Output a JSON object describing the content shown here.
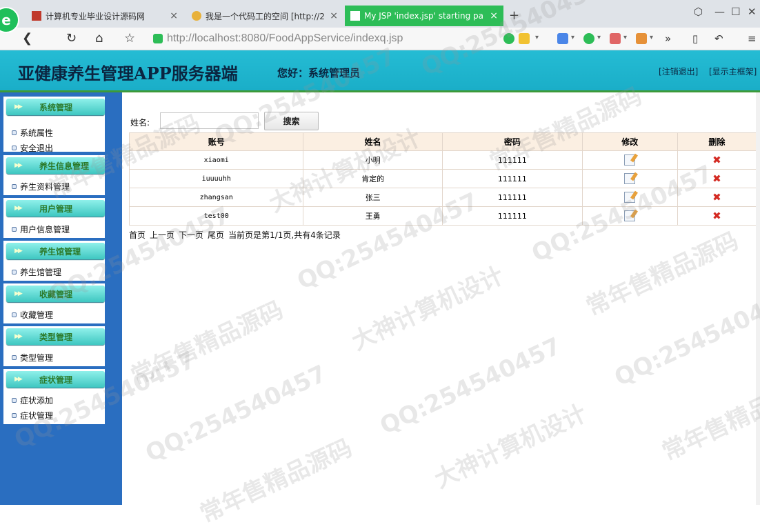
{
  "browser": {
    "logo_glyph": "e",
    "tabs": [
      {
        "label": "计算机专业毕业设计源码网",
        "active": false
      },
      {
        "label": "我是一个代码工的空间 [http://2",
        "active": false
      },
      {
        "label": "My JSP 'index.jsp' starting pa",
        "active": true
      }
    ],
    "new_tab": "+",
    "url_host": "http://localhost",
    "url_path": ":8080/FoodAppService/indexq.jsp",
    "close_glyph": "×"
  },
  "header": {
    "title": "亚健康养生管理APP服务器端",
    "greeting": "您好：系统管理员",
    "logout": "[注销退出]",
    "show_frame": "[显示主框架]"
  },
  "sidebar": {
    "sections": [
      {
        "title": "系统管理",
        "items": [
          "系统属性",
          "安全退出"
        ]
      },
      {
        "title": "养生信息管理",
        "items": [
          "养生资料管理"
        ]
      },
      {
        "title": "用户管理",
        "items": [
          "用户信息管理"
        ]
      },
      {
        "title": "养生馆管理",
        "items": [
          "养生馆管理"
        ]
      },
      {
        "title": "收藏管理",
        "items": [
          "收藏管理"
        ]
      },
      {
        "title": "类型管理",
        "items": [
          "类型管理"
        ]
      },
      {
        "title": "症状管理",
        "items": [
          "症状添加",
          "症状管理"
        ]
      }
    ]
  },
  "search": {
    "label": "姓名:",
    "value": "",
    "button": "搜索"
  },
  "table": {
    "headers": [
      "账号",
      "姓名",
      "密码",
      "修改",
      "删除"
    ],
    "rows": [
      {
        "account": "xiaomi",
        "name": "小明",
        "password": "111111"
      },
      {
        "account": "iuuuuhh",
        "name": "肯定的",
        "password": "111111"
      },
      {
        "account": "zhangsan",
        "name": "张三",
        "password": "111111"
      },
      {
        "account": "test00",
        "name": "王勇",
        "password": "111111"
      }
    ]
  },
  "pager": {
    "first": "首页",
    "prev": "上一页",
    "next": "下一页",
    "last": "尾页",
    "info": "当前页是第1/1页,共有4条记录"
  },
  "watermarks": [
    "QQ:254540457",
    "大神计算机设计",
    "常年售精品源码"
  ],
  "colors": {
    "header_bg": "#1fb6cf",
    "sidebar_bg": "#2a6ec0",
    "active_tab": "#2dbd57",
    "table_header_bg": "#fbefe2"
  }
}
